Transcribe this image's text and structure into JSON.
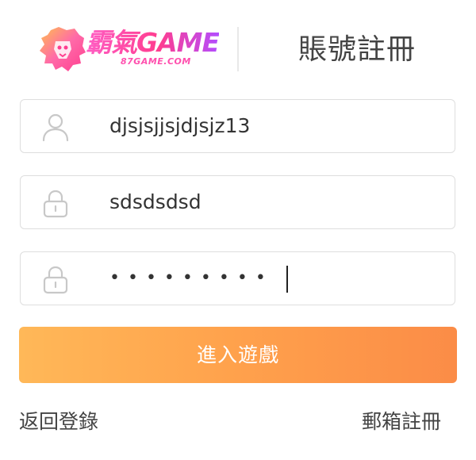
{
  "brand": {
    "logo_text": "霸氣GAME",
    "logo_subtext": "87GAME.COM",
    "colors": {
      "logo_pink": "#ff3d8f",
      "logo_purple": "#b34dff"
    }
  },
  "header": {
    "title": "賬號註冊"
  },
  "form": {
    "username": {
      "icon": "user-icon",
      "value": "djsjsjjsjdjsjz13"
    },
    "password": {
      "icon": "lock-icon",
      "value": "sdsdsdsd"
    },
    "confirm_password": {
      "icon": "lock-icon",
      "masked_value": "•••••••••"
    },
    "submit_label": "進入遊戲"
  },
  "footer": {
    "back_to_login": "返回登錄",
    "email_register": "郵箱註冊"
  },
  "colors": {
    "button_start": "#ffb858",
    "button_end": "#fb8c47",
    "border": "#dedede",
    "icon": "#c8c8c8"
  }
}
